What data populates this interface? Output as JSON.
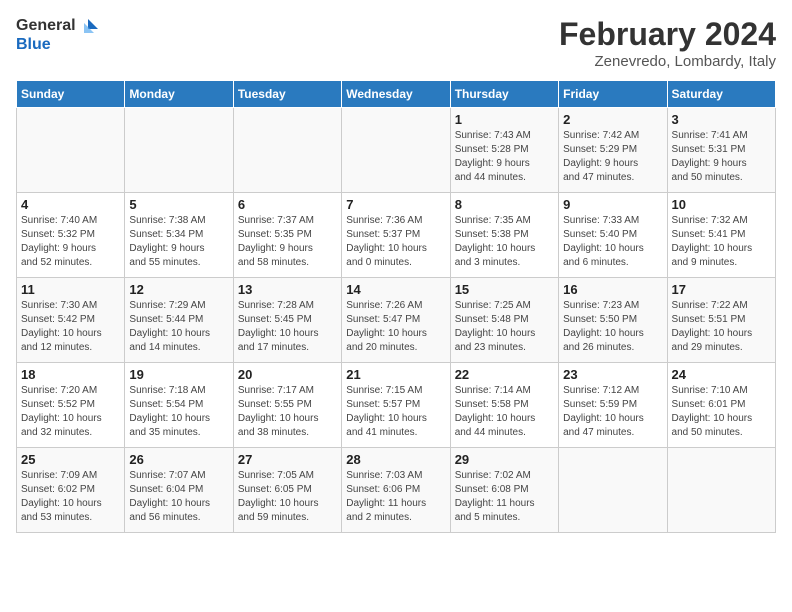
{
  "header": {
    "logo_line1": "General",
    "logo_line2": "Blue",
    "month_year": "February 2024",
    "location": "Zenevredo, Lombardy, Italy"
  },
  "days_of_week": [
    "Sunday",
    "Monday",
    "Tuesday",
    "Wednesday",
    "Thursday",
    "Friday",
    "Saturday"
  ],
  "weeks": [
    [
      {
        "day": "",
        "info": ""
      },
      {
        "day": "",
        "info": ""
      },
      {
        "day": "",
        "info": ""
      },
      {
        "day": "",
        "info": ""
      },
      {
        "day": "1",
        "info": "Sunrise: 7:43 AM\nSunset: 5:28 PM\nDaylight: 9 hours\nand 44 minutes."
      },
      {
        "day": "2",
        "info": "Sunrise: 7:42 AM\nSunset: 5:29 PM\nDaylight: 9 hours\nand 47 minutes."
      },
      {
        "day": "3",
        "info": "Sunrise: 7:41 AM\nSunset: 5:31 PM\nDaylight: 9 hours\nand 50 minutes."
      }
    ],
    [
      {
        "day": "4",
        "info": "Sunrise: 7:40 AM\nSunset: 5:32 PM\nDaylight: 9 hours\nand 52 minutes."
      },
      {
        "day": "5",
        "info": "Sunrise: 7:38 AM\nSunset: 5:34 PM\nDaylight: 9 hours\nand 55 minutes."
      },
      {
        "day": "6",
        "info": "Sunrise: 7:37 AM\nSunset: 5:35 PM\nDaylight: 9 hours\nand 58 minutes."
      },
      {
        "day": "7",
        "info": "Sunrise: 7:36 AM\nSunset: 5:37 PM\nDaylight: 10 hours\nand 0 minutes."
      },
      {
        "day": "8",
        "info": "Sunrise: 7:35 AM\nSunset: 5:38 PM\nDaylight: 10 hours\nand 3 minutes."
      },
      {
        "day": "9",
        "info": "Sunrise: 7:33 AM\nSunset: 5:40 PM\nDaylight: 10 hours\nand 6 minutes."
      },
      {
        "day": "10",
        "info": "Sunrise: 7:32 AM\nSunset: 5:41 PM\nDaylight: 10 hours\nand 9 minutes."
      }
    ],
    [
      {
        "day": "11",
        "info": "Sunrise: 7:30 AM\nSunset: 5:42 PM\nDaylight: 10 hours\nand 12 minutes."
      },
      {
        "day": "12",
        "info": "Sunrise: 7:29 AM\nSunset: 5:44 PM\nDaylight: 10 hours\nand 14 minutes."
      },
      {
        "day": "13",
        "info": "Sunrise: 7:28 AM\nSunset: 5:45 PM\nDaylight: 10 hours\nand 17 minutes."
      },
      {
        "day": "14",
        "info": "Sunrise: 7:26 AM\nSunset: 5:47 PM\nDaylight: 10 hours\nand 20 minutes."
      },
      {
        "day": "15",
        "info": "Sunrise: 7:25 AM\nSunset: 5:48 PM\nDaylight: 10 hours\nand 23 minutes."
      },
      {
        "day": "16",
        "info": "Sunrise: 7:23 AM\nSunset: 5:50 PM\nDaylight: 10 hours\nand 26 minutes."
      },
      {
        "day": "17",
        "info": "Sunrise: 7:22 AM\nSunset: 5:51 PM\nDaylight: 10 hours\nand 29 minutes."
      }
    ],
    [
      {
        "day": "18",
        "info": "Sunrise: 7:20 AM\nSunset: 5:52 PM\nDaylight: 10 hours\nand 32 minutes."
      },
      {
        "day": "19",
        "info": "Sunrise: 7:18 AM\nSunset: 5:54 PM\nDaylight: 10 hours\nand 35 minutes."
      },
      {
        "day": "20",
        "info": "Sunrise: 7:17 AM\nSunset: 5:55 PM\nDaylight: 10 hours\nand 38 minutes."
      },
      {
        "day": "21",
        "info": "Sunrise: 7:15 AM\nSunset: 5:57 PM\nDaylight: 10 hours\nand 41 minutes."
      },
      {
        "day": "22",
        "info": "Sunrise: 7:14 AM\nSunset: 5:58 PM\nDaylight: 10 hours\nand 44 minutes."
      },
      {
        "day": "23",
        "info": "Sunrise: 7:12 AM\nSunset: 5:59 PM\nDaylight: 10 hours\nand 47 minutes."
      },
      {
        "day": "24",
        "info": "Sunrise: 7:10 AM\nSunset: 6:01 PM\nDaylight: 10 hours\nand 50 minutes."
      }
    ],
    [
      {
        "day": "25",
        "info": "Sunrise: 7:09 AM\nSunset: 6:02 PM\nDaylight: 10 hours\nand 53 minutes."
      },
      {
        "day": "26",
        "info": "Sunrise: 7:07 AM\nSunset: 6:04 PM\nDaylight: 10 hours\nand 56 minutes."
      },
      {
        "day": "27",
        "info": "Sunrise: 7:05 AM\nSunset: 6:05 PM\nDaylight: 10 hours\nand 59 minutes."
      },
      {
        "day": "28",
        "info": "Sunrise: 7:03 AM\nSunset: 6:06 PM\nDaylight: 11 hours\nand 2 minutes."
      },
      {
        "day": "29",
        "info": "Sunrise: 7:02 AM\nSunset: 6:08 PM\nDaylight: 11 hours\nand 5 minutes."
      },
      {
        "day": "",
        "info": ""
      },
      {
        "day": "",
        "info": ""
      }
    ]
  ]
}
